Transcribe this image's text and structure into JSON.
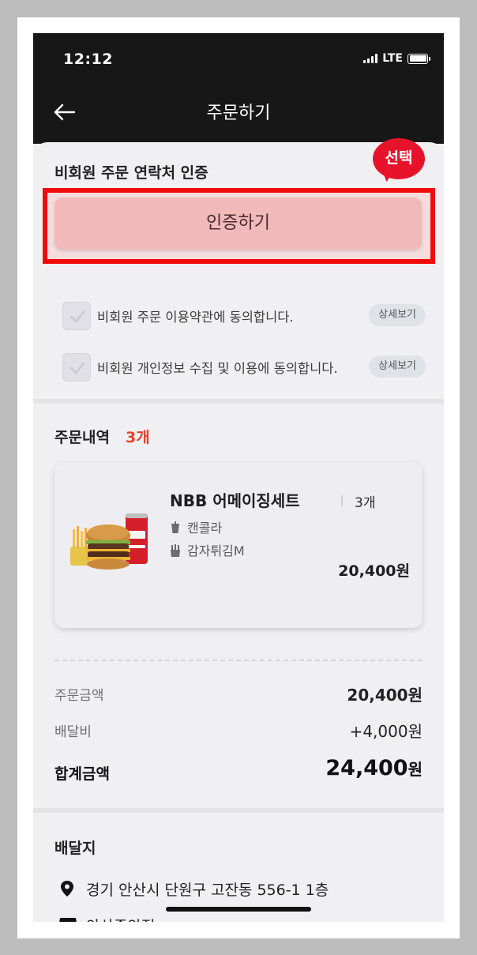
{
  "status_bar": {
    "time": "12:12",
    "network": "LTE"
  },
  "nav": {
    "title": "주문하기"
  },
  "auth": {
    "section_title": "비회원 주문 연락처 인증",
    "badge_label": "선택",
    "button_label": "인증하기",
    "agreements": [
      {
        "text": "비회원 주문 이용약관에 동의합니다.",
        "detail_label": "상세보기",
        "checked": true
      },
      {
        "text": "비회원 개인정보 수집 및 이용에 동의합니다.",
        "detail_label": "상세보기",
        "checked": true
      }
    ]
  },
  "order": {
    "section_title": "주문내역",
    "count": "3개",
    "item": {
      "name": "NBB 어메이징세트",
      "quantity": "3개",
      "options": [
        {
          "icon": "drink-icon",
          "label": "캔콜라"
        },
        {
          "icon": "fries-icon",
          "label": "감자튀김M"
        }
      ],
      "price": "20,400원"
    }
  },
  "summary": {
    "order_amount_label": "주문금액",
    "order_amount": "20,400원",
    "delivery_fee_label": "배달비",
    "delivery_fee": "+4,000원",
    "total_label": "합계금액",
    "total_number": "24,400",
    "total_unit": "원"
  },
  "delivery": {
    "section_title": "배달지",
    "address": "경기 안산시 단원구 고잔동 556-1 1층",
    "store": "안산중앙점"
  },
  "colors": {
    "accent_red": "#e8132a",
    "highlight_border": "#f00b0b",
    "count_orange": "#e8412a",
    "header_bg": "#171717"
  }
}
